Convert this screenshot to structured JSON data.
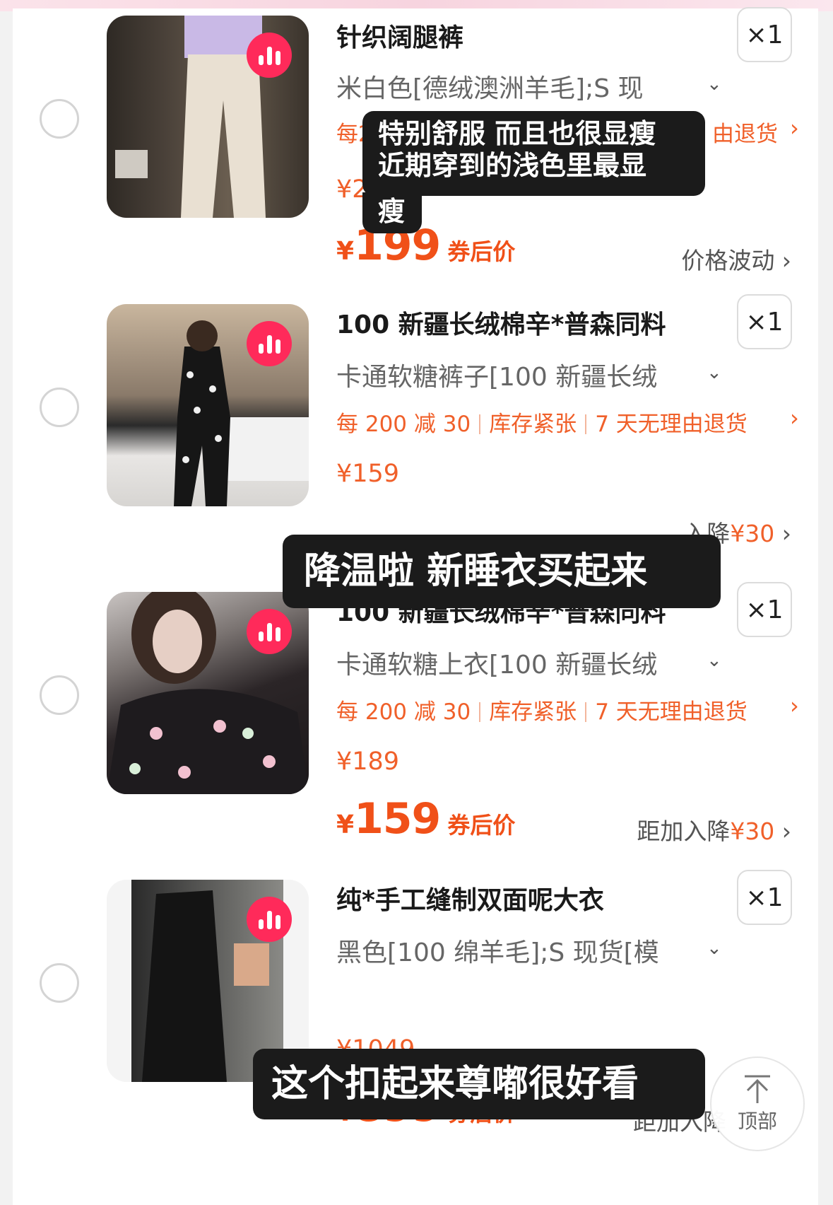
{
  "items": [
    {
      "title": "针织阔腿裤",
      "qty": "×1",
      "spec": "米白色[德绒澳洲羊毛];S 现",
      "promo": "每2",
      "promo_tail": "由退货",
      "orig_price": "¥22",
      "final_yen": "¥",
      "final_price": "199",
      "final_tag": "券后价",
      "side_text": "价格波动"
    },
    {
      "title": "100 新疆长绒棉辛*普森同料",
      "qty": "×1",
      "spec": "卡通软糖裤子[100 新疆长绒",
      "promo_a": "每 200 减 30",
      "promo_b": "库存紧张",
      "promo_c": "7 天无理由退货",
      "orig_price": "¥159",
      "side_text_a": "入降",
      "side_text_b": "¥30"
    },
    {
      "title": "100 新疆长绒棉辛*普森同料",
      "qty": "×1",
      "spec": "卡通软糖上衣[100 新疆长绒",
      "promo_a": "每 200 减 30",
      "promo_b": "库存紧张",
      "promo_c": "7 天无理由退货",
      "orig_price": "¥189",
      "final_yen": "¥",
      "final_price": "159",
      "final_tag": "券后价",
      "side_text_a": "距加入降",
      "side_text_b": "¥30"
    },
    {
      "title": "纯*手工缝制双面呢大衣",
      "qty": "×1",
      "spec": "黑色[100 绵羊毛];S 现货[模",
      "orig_price": "¥1049",
      "final_yen": "¥",
      "final_price": "899",
      "final_tag": "券后价",
      "side_text": "距加入降"
    }
  ],
  "captions": {
    "c1": [
      "特别舒服 而且也很显瘦",
      "近期穿到的浅色里最显",
      "瘦"
    ],
    "c2": "降温啦 新睡衣买起来",
    "c3": "这个扣起来尊嘟很好看"
  },
  "top_button": {
    "label": "顶部"
  },
  "colors": {
    "accent": "#f0602a",
    "badge": "#ff2a5a",
    "caption_bg": "#1b1b1b"
  }
}
